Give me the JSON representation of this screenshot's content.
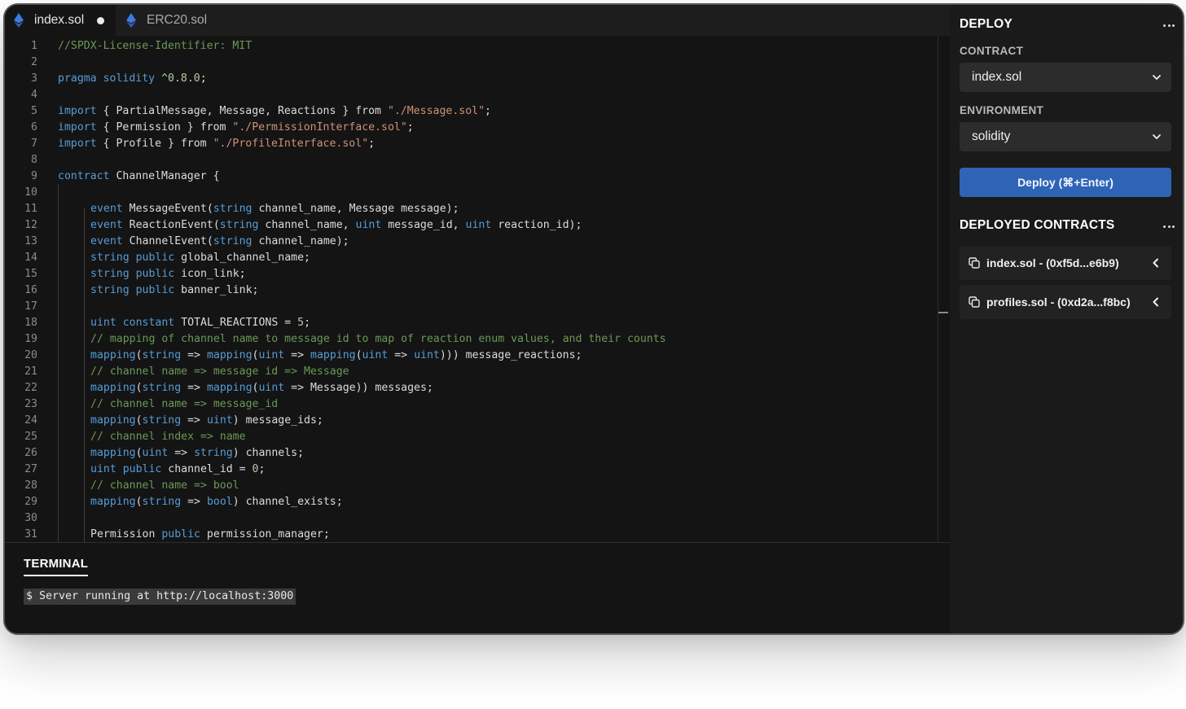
{
  "tabs": [
    {
      "label": "index.sol",
      "modified": true
    },
    {
      "label": "ERC20.sol",
      "modified": false
    }
  ],
  "editor": {
    "lines": [
      {
        "n": "1"
      },
      {
        "n": "2"
      },
      {
        "n": "3"
      },
      {
        "n": "4"
      },
      {
        "n": "5"
      },
      {
        "n": "6"
      },
      {
        "n": "7"
      },
      {
        "n": "8"
      },
      {
        "n": "9"
      },
      {
        "n": "10"
      },
      {
        "n": "11"
      },
      {
        "n": "12"
      },
      {
        "n": "13"
      },
      {
        "n": "14"
      },
      {
        "n": "15"
      },
      {
        "n": "16"
      },
      {
        "n": "17"
      },
      {
        "n": "18"
      },
      {
        "n": "19"
      },
      {
        "n": "20"
      },
      {
        "n": "21"
      },
      {
        "n": "22"
      },
      {
        "n": "23"
      },
      {
        "n": "24"
      },
      {
        "n": "25"
      },
      {
        "n": "26"
      },
      {
        "n": "27"
      },
      {
        "n": "28"
      },
      {
        "n": "29"
      },
      {
        "n": "30"
      },
      {
        "n": "31"
      }
    ],
    "code": {
      "l1": "//SPDX-License-Identifier: MIT",
      "l3_kw1": "pragma",
      "l3_kw2": "solidity",
      "l3_ver": "^0.8.0",
      "l3_end": ";",
      "l5_kw": "import",
      "l5_mid": " { PartialMessage, Message, Reactions } ",
      "l5_from": "from",
      "l5_str": "\"./Message.sol\"",
      "l5_end": ";",
      "l6_kw": "import",
      "l6_mid": " { Permission } ",
      "l6_from": "from",
      "l6_str": "\"./PermissionInterface.sol\"",
      "l6_end": ";",
      "l7_kw": "import",
      "l7_mid": " { Profile } ",
      "l7_from": "from",
      "l7_str": "\"./ProfileInterface.sol\"",
      "l7_end": ";",
      "l9_kw": "contract",
      "l9_rest": " ChannelManager {",
      "l11_kw": "event",
      "l11_a": " MessageEvent(",
      "l11_t": "string",
      "l11_b": " channel_name, Message message);",
      "l12_kw": "event",
      "l12_a": " ReactionEvent(",
      "l12_t1": "string",
      "l12_b": " channel_name, ",
      "l12_t2": "uint",
      "l12_c": " message_id, ",
      "l12_t3": "uint",
      "l12_d": " reaction_id);",
      "l13_kw": "event",
      "l13_a": " ChannelEvent(",
      "l13_t": "string",
      "l13_b": " channel_name);",
      "l14_t": "string",
      "l14_p": "public",
      "l14_rest": " global_channel_name;",
      "l15_t": "string",
      "l15_p": "public",
      "l15_rest": " icon_link;",
      "l16_t": "string",
      "l16_p": "public",
      "l16_rest": " banner_link;",
      "l18_t": "uint",
      "l18_c": "constant",
      "l18_a": " TOTAL_REACTIONS = ",
      "l18_n": "5",
      "l18_end": ";",
      "l19": "// mapping of channel name to message id to map of reaction enum values, and their counts",
      "l20_m1": "mapping",
      "l20_a": "(",
      "l20_t1": "string",
      "l20_b": " => ",
      "l20_m2": "mapping",
      "l20_c": "(",
      "l20_t2": "uint",
      "l20_d": " => ",
      "l20_m3": "mapping",
      "l20_e": "(",
      "l20_t3": "uint",
      "l20_f": " => ",
      "l20_t4": "uint",
      "l20_g": "))) message_reactions;",
      "l21": "// channel name => message id => Message",
      "l22_m1": "mapping",
      "l22_a": "(",
      "l22_t1": "string",
      "l22_b": " => ",
      "l22_m2": "mapping",
      "l22_c": "(",
      "l22_t2": "uint",
      "l22_d": " => Message)) messages;",
      "l23": "// channel name => message_id",
      "l24_m": "mapping",
      "l24_a": "(",
      "l24_t1": "string",
      "l24_b": " => ",
      "l24_t2": "uint",
      "l24_c": ") message_ids;",
      "l25": "// channel index => name",
      "l26_m": "mapping",
      "l26_a": "(",
      "l26_t1": "uint",
      "l26_b": " => ",
      "l26_t2": "string",
      "l26_c": ") channels;",
      "l27_t": "uint",
      "l27_p": "public",
      "l27_a": " channel_id = ",
      "l27_n": "0",
      "l27_end": ";",
      "l28": "// channel name => bool",
      "l29_m": "mapping",
      "l29_a": "(",
      "l29_t1": "string",
      "l29_b": " => ",
      "l29_t2": "bool",
      "l29_c": ") channel_exists;",
      "l31_a": "Permission ",
      "l31_p": "public",
      "l31_b": " permission_manager;"
    }
  },
  "terminal": {
    "title": "TERMINAL",
    "output": "$ Server running at http://localhost:3000"
  },
  "deploy": {
    "title": "DEPLOY",
    "contract_label": "CONTRACT",
    "contract_value": "index.sol",
    "environment_label": "ENVIRONMENT",
    "environment_value": "solidity",
    "button_label": "Deploy (⌘+Enter)"
  },
  "deployed": {
    "title": "DEPLOYED CONTRACTS",
    "items": [
      {
        "label": "index.sol - (0xf5d...e6b9)"
      },
      {
        "label": "profiles.sol - (0xd2a...f8bc)"
      }
    ]
  },
  "colors": {
    "keyword": "#569cd6",
    "string": "#ce9178",
    "comment": "#6a9955",
    "number": "#b5cea8",
    "accent_button": "#2f63b6",
    "ethereum_icon": "#3d7be0"
  },
  "icons": {
    "tab_icon": "ethereum-icon",
    "modified_indicator": "unsaved-dot-icon",
    "select_arrow": "chevron-down-icon",
    "panel_menu": "more-horizontal-icon",
    "contract_copy": "copy-icon",
    "contract_expand": "chevron-left-icon"
  }
}
